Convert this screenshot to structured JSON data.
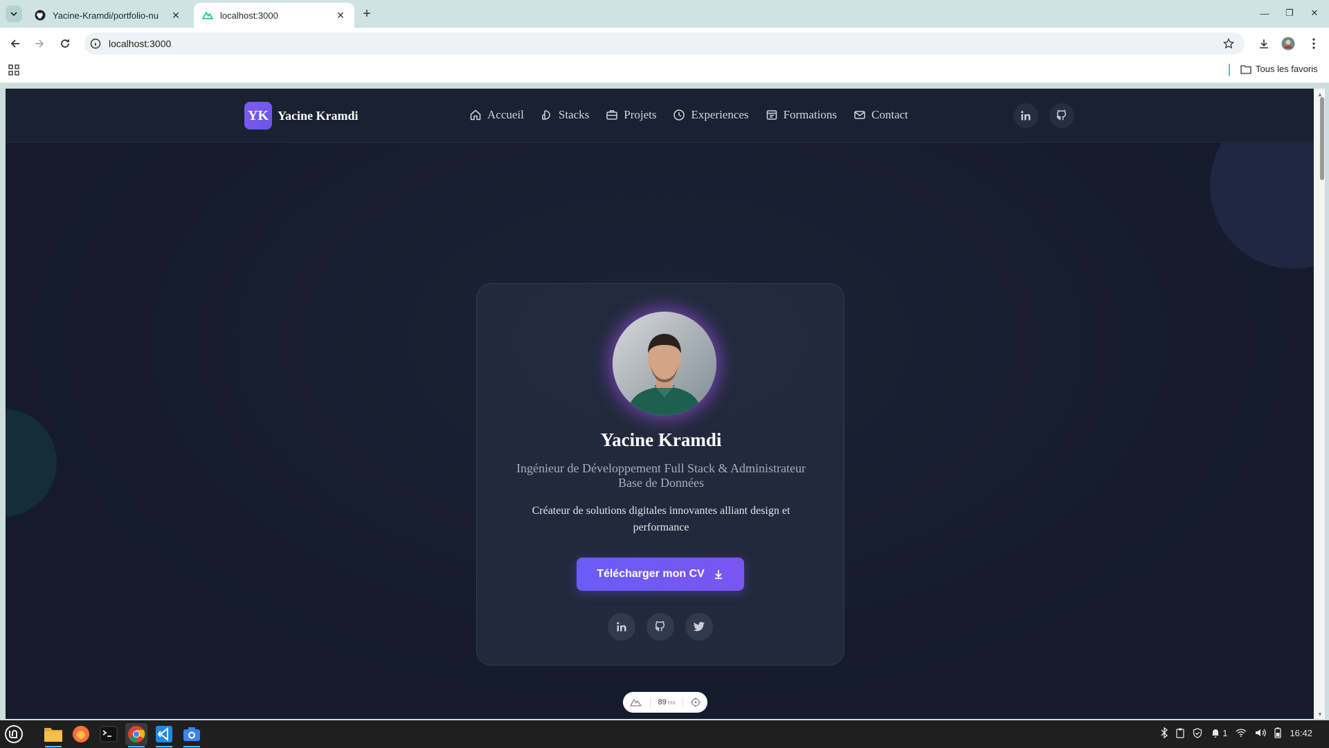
{
  "browser": {
    "tabs": [
      {
        "title": "Yacine-Kramdi/portfolio-nu",
        "favicon": "github-icon",
        "active": false
      },
      {
        "title": "localhost:3000",
        "favicon": "nuxt-icon",
        "active": true
      }
    ],
    "address": "localhost:3000",
    "bookmarks": {
      "favorites_label": "Tous les favoris"
    }
  },
  "site": {
    "logo_initials": "YK",
    "logo_name": "Yacine Kramdi",
    "nav": [
      {
        "label": "Accueil",
        "icon": "home-icon"
      },
      {
        "label": "Stacks",
        "icon": "stack-icon"
      },
      {
        "label": "Projets",
        "icon": "briefcase-icon"
      },
      {
        "label": "Experiences",
        "icon": "clock-icon"
      },
      {
        "label": "Formations",
        "icon": "book-icon"
      },
      {
        "label": "Contact",
        "icon": "mail-icon"
      }
    ],
    "header_social": [
      "linkedin-icon",
      "github-icon"
    ]
  },
  "hero": {
    "name": "Yacine Kramdi",
    "role": "Ingénieur de Développement Full Stack & Administrateur Base de Données",
    "description": "Créateur de solutions digitales innovantes alliant design et performance",
    "cv_button": "Télécharger mon CV",
    "social": [
      "linkedin-icon",
      "github-icon",
      "twitter-icon"
    ]
  },
  "devtools": {
    "timing": "89",
    "unit": "ms"
  },
  "taskbar": {
    "apps": [
      "files-icon",
      "firefox-icon",
      "terminal-icon",
      "chrome-icon",
      "vscode-icon",
      "screenshot-icon"
    ],
    "tray": {
      "notifications_count": "1",
      "clock": "16:42"
    }
  },
  "colors": {
    "accent": "#6a5cf6",
    "page_bg": "#161d2e",
    "card_bg": "#262c3f"
  }
}
